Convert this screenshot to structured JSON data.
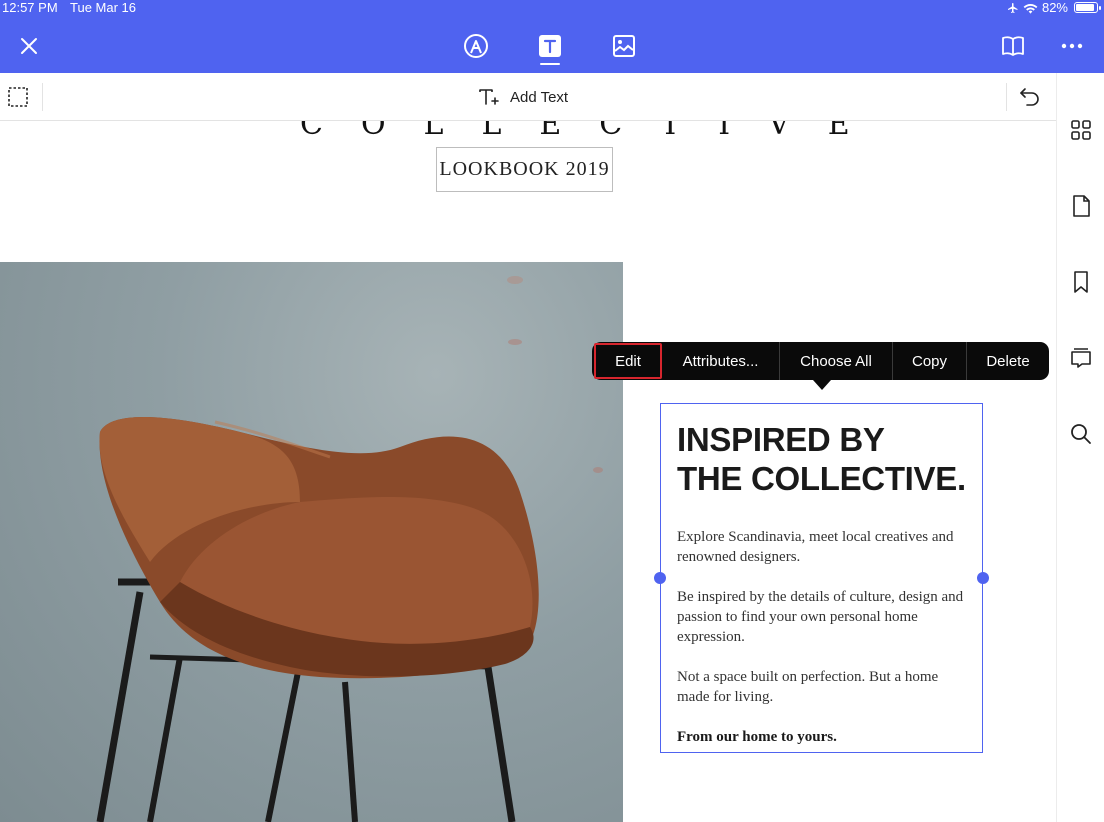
{
  "status_bar": {
    "time": "12:57 PM",
    "date": "Tue Mar 16",
    "battery": "82%",
    "battery_level": 0.82
  },
  "toolbar": {
    "close_icon": "close-icon",
    "tabs": [
      "annotate-icon",
      "text-icon",
      "image-icon"
    ],
    "active_tab": "text-icon",
    "right_icons": [
      "book-icon",
      "more-icon"
    ]
  },
  "subbar": {
    "add_text_label": "Add Text"
  },
  "sidebar": {
    "icons": [
      "grid-icon",
      "page-icon",
      "bookmark-icon",
      "comment-icon",
      "search-icon"
    ]
  },
  "document": {
    "header_strip": "COLLECTIVE",
    "lookbook": "LOOKBOOK 2019",
    "heading_line1": "INSPIRED BY",
    "heading_line2": "THE COLLECTIVE.",
    "para1": "Explore Scandinavia, meet local creatives and renowned designers.",
    "para2": "Be inspired by the details of culture, design and passion to find your own personal home expression.",
    "para3": "Not a space built on perfection. But a home made for living.",
    "para4": "From our home to yours."
  },
  "context_menu": {
    "edit": "Edit",
    "attributes": "Attributes...",
    "choose_all": "Choose All",
    "copy": "Copy",
    "delete": "Delete"
  },
  "colors": {
    "accent": "#4f63f0",
    "menu_bg": "#0a0a0a",
    "highlight": "#d7262e"
  }
}
